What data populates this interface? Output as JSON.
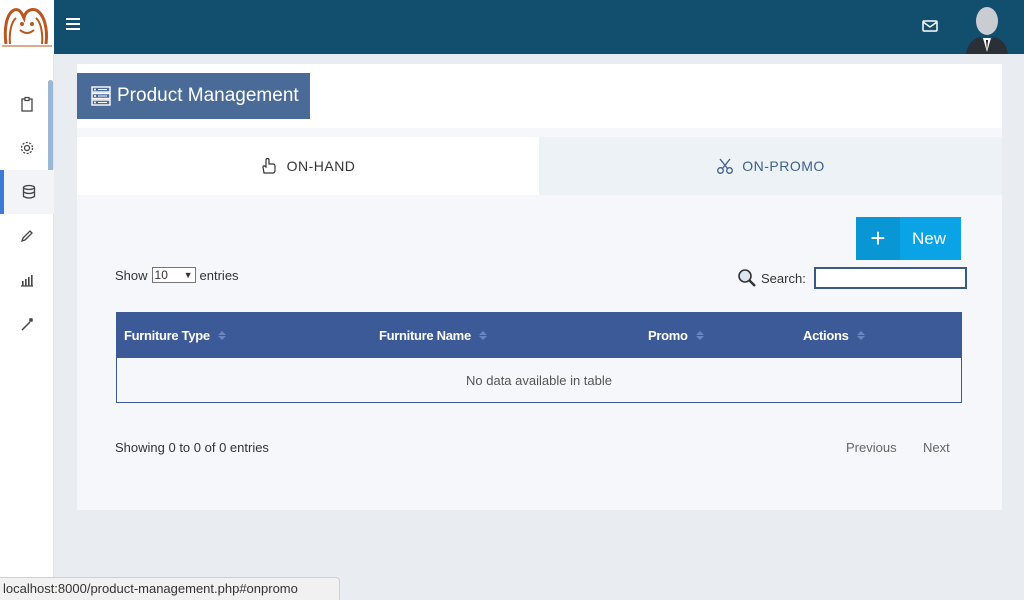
{
  "header": {
    "menu_icon": "hamburger-icon",
    "mail_icon": "mail-icon",
    "avatar_icon": "user-avatar"
  },
  "sidebar": {
    "items": [
      {
        "icon": "clipboard-icon"
      },
      {
        "icon": "gear-icon"
      },
      {
        "icon": "database-icon",
        "active": true
      },
      {
        "icon": "pencil-icon"
      },
      {
        "icon": "bar-chart-icon"
      },
      {
        "icon": "magic-wand-icon"
      }
    ]
  },
  "page": {
    "title": "Product Management",
    "title_icon": "server-icon"
  },
  "tabs": [
    {
      "label": "ON-HAND",
      "icon": "hand-icon"
    },
    {
      "label": "ON-PROMO",
      "icon": "scissors-icon"
    }
  ],
  "new_button": {
    "label": "New",
    "icon": "+"
  },
  "length": {
    "show": "Show",
    "value": "10",
    "entries": "entries"
  },
  "search": {
    "label": "Search:",
    "value": ""
  },
  "table": {
    "columns": [
      "Furniture Type",
      "Furniture Name",
      "Promo",
      "Actions"
    ],
    "empty_message": "No data available in table"
  },
  "footer": {
    "info": "Showing 0 to 0 of 0 entries",
    "previous": "Previous",
    "next": "Next"
  },
  "status_url": "localhost:8000/product-management.php#onpromo",
  "colors": {
    "topbar": "#124f6e",
    "title_bg": "#4a6b97",
    "table_header": "#3c5998",
    "new_button": "#0aa4e6"
  }
}
